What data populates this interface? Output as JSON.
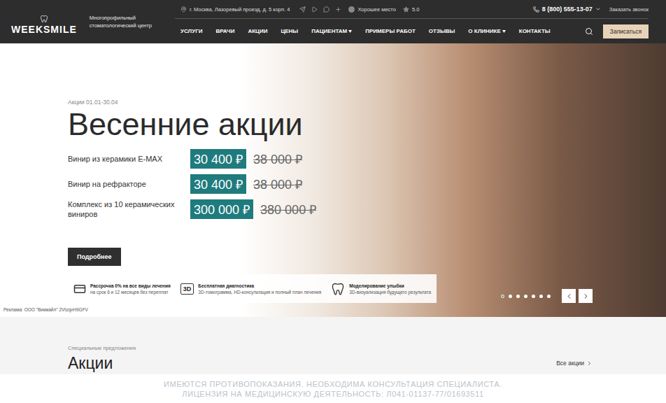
{
  "header": {
    "logo": "WEEKSMILE",
    "tagline": "Многопрофильный стоматологический центр",
    "address": "г. Москва, Лазоревый проезд, д. 5 корп. 4",
    "badge": "Хорошее место",
    "rating": "5.0",
    "phone": "8 (800) 555-13-07",
    "callback": "Заказать звонок",
    "cta": "Записаться"
  },
  "nav": [
    {
      "label": "УСЛУГИ",
      "dropdown": false
    },
    {
      "label": "ВРАЧИ",
      "dropdown": false
    },
    {
      "label": "АКЦИИ",
      "dropdown": false
    },
    {
      "label": "ЦЕНЫ",
      "dropdown": false
    },
    {
      "label": "ПАЦИЕНТАМ",
      "dropdown": true
    },
    {
      "label": "ПРИМЕРЫ РАБОТ",
      "dropdown": false
    },
    {
      "label": "ОТЗЫВЫ",
      "dropdown": false
    },
    {
      "label": "О КЛИНИКЕ",
      "dropdown": true
    },
    {
      "label": "КОНТАКТЫ",
      "dropdown": false
    }
  ],
  "hero": {
    "period": "Акции 01.01-30.04",
    "title": "Весенние акции",
    "offers": [
      {
        "name": "Винир из керамики E-MAX",
        "price": "30 400 ₽",
        "old_price": "38 000 ₽"
      },
      {
        "name": "Винир на рефракторе",
        "price": "30 400 ₽",
        "old_price": "38 000 ₽"
      },
      {
        "name": "Комплекс из 10 керамических виниров",
        "price": "300 000 ₽",
        "old_price": "380 000 ₽"
      }
    ],
    "button": "Подробнее",
    "features": [
      {
        "kind": "card",
        "title": "Рассрочка 0% на все виды лечения",
        "text": "на срок 6 и 12 месяцев без переплат"
      },
      {
        "kind": "badge",
        "badge": "3D",
        "title": "Бесплатная диагностика",
        "text": "3D-томограмма, HD-консультация и полный план лечения"
      },
      {
        "kind": "tooth",
        "title": "Моделирование улыбки",
        "text": "3D-визуализация будущего результата"
      }
    ],
    "slides": [
      {
        "selected": true
      },
      {
        "selected": false
      },
      {
        "selected": false
      },
      {
        "selected": false
      },
      {
        "selected": false
      },
      {
        "selected": false
      },
      {
        "selected": false
      }
    ],
    "ad": "Реклама: ООО \"Викмайл\" 2VtzqvH9GFV"
  },
  "offers_section": {
    "caption": "Специальные предложения",
    "title": "Акции",
    "link": "Все акции"
  },
  "disclaimer": [
    "ИМЕЮТСЯ ПРОТИВОПОКАЗАНИЯ. НЕОБХОДИМА КОНСУЛЬТАЦИЯ СПЕЦИАЛИСТА.",
    "ЛИЦЕНЗИЯ НА МЕДИЦИНСКУЮ ДЕЯТЕЛЬНОСТЬ: Л041-01137-77/01693511"
  ]
}
